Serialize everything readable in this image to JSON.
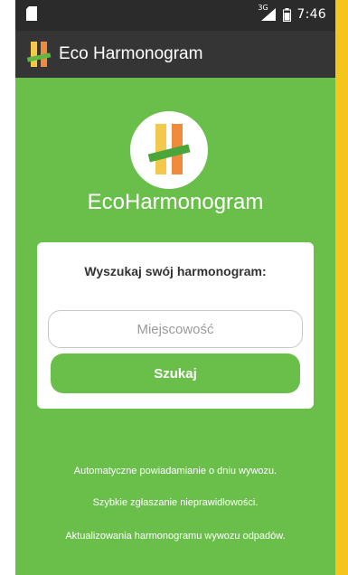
{
  "status_bar": {
    "signal_label": "3G",
    "time": "7:46",
    "icons": [
      "sd-card-icon",
      "signal-icon",
      "battery-icon"
    ]
  },
  "app_bar": {
    "title": "Eco Harmonogram",
    "icon": "app-logo-icon"
  },
  "brand": {
    "name": "EcoHarmonogram",
    "icon": "app-logo-icon"
  },
  "search_card": {
    "title": "Wyszukaj swój harmonogram:",
    "input_placeholder": "Miejscowość",
    "input_value": "",
    "button_label": "Szukaj"
  },
  "features": [
    "Automatyczne powiadamianie o dniu wywozu.",
    "Szybkie zgłaszanie nieprawidłowości.",
    "Aktualizowania harmonogramu wywozu odpadów."
  ],
  "colors": {
    "background_green": "#6abf4b",
    "app_bar": "#353535",
    "status_bar": "#2b2b2b",
    "accent_yellow": "#f6c51b",
    "logo_orange": "#f08a3c",
    "logo_yellow": "#f2c94c"
  }
}
